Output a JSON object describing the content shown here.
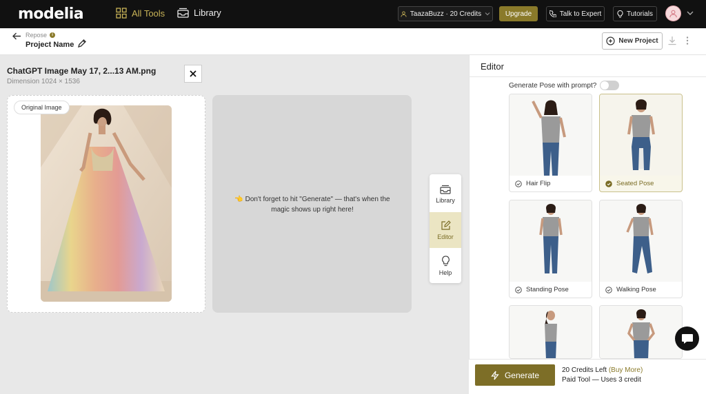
{
  "topbar": {
    "logo": "modelia",
    "nav": {
      "all_tools": "All Tools",
      "library": "Library"
    },
    "credits_pill": "TaazaBuzz · 20 Credits",
    "upgrade": "Upgrade",
    "talk_to_expert": "Talk to Expert",
    "tutorials": "Tutorials"
  },
  "subheader": {
    "breadcrumb": "Repose",
    "project_name": "Project Name",
    "new_project": "New Project"
  },
  "file": {
    "title": "ChatGPT Image May 17, 2...13 AM.png",
    "dimension": "Dimension 1024 × 1536"
  },
  "original_label": "Original Image",
  "result_message": "👈 Don't forget to hit \"Generate\" — that's when the magic shows up right here!",
  "dock": [
    {
      "label": "Library",
      "icon": "inbox-icon"
    },
    {
      "label": "Editor",
      "icon": "edit-icon"
    },
    {
      "label": "Help",
      "icon": "lightbulb-icon"
    }
  ],
  "editor": {
    "title": "Editor",
    "generate_pose_prompt": "Generate Pose with prompt?",
    "poses": [
      {
        "label": "Hair Flip",
        "selected": false
      },
      {
        "label": "Seated Pose",
        "selected": true
      },
      {
        "label": "Standing Pose",
        "selected": false
      },
      {
        "label": "Walking Pose",
        "selected": false
      },
      {
        "label": "",
        "selected": false
      },
      {
        "label": "",
        "selected": false
      }
    ]
  },
  "generate": {
    "button": "Generate",
    "credits_left": "20 Credits Left",
    "buy_more": "(Buy More)",
    "paid_tool": "Paid Tool — Uses 3 credit"
  },
  "colors": {
    "accent": "#7d6e27",
    "topbar": "#111111",
    "selected_bg": "#ebe5c3"
  }
}
